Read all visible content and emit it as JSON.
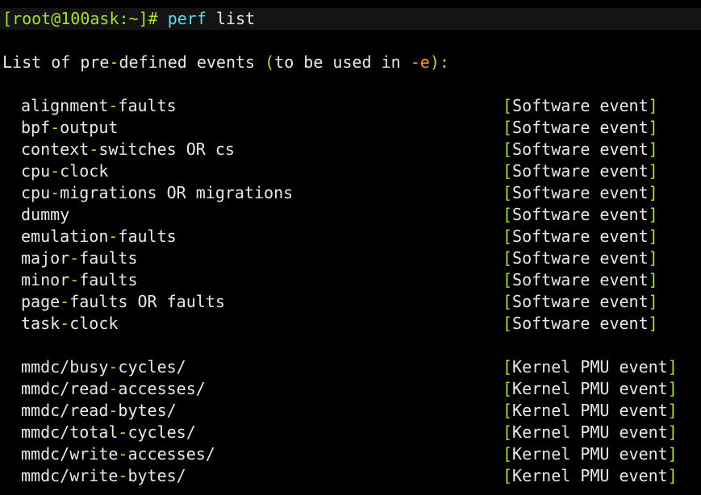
{
  "prompt": {
    "user_host": "[root@100ask:~]#",
    "command": "perf",
    "argument": "list"
  },
  "header": {
    "text_start": "List of pre",
    "dash": "-",
    "text_mid": "defined events ",
    "paren_open": "(",
    "text_in": "to be used in ",
    "flag": "-e",
    "paren_close": ")",
    "colon": ":"
  },
  "software_events": [
    {
      "name": "alignment-faults",
      "type": "Software event"
    },
    {
      "name": "bpf-output",
      "type": "Software event"
    },
    {
      "name": "context-switches OR cs",
      "type": "Software event"
    },
    {
      "name": "cpu-clock",
      "type": "Software event"
    },
    {
      "name": "cpu-migrations OR migrations",
      "type": "Software event"
    },
    {
      "name": "dummy",
      "type": "Software event"
    },
    {
      "name": "emulation-faults",
      "type": "Software event"
    },
    {
      "name": "major-faults",
      "type": "Software event"
    },
    {
      "name": "minor-faults",
      "type": "Software event"
    },
    {
      "name": "page-faults OR faults",
      "type": "Software event"
    },
    {
      "name": "task-clock",
      "type": "Software event"
    }
  ],
  "pmu_events": [
    {
      "name": "mmdc/busy-cycles/",
      "type": "Kernel PMU event"
    },
    {
      "name": "mmdc/read-accesses/",
      "type": "Kernel PMU event"
    },
    {
      "name": "mmdc/read-bytes/",
      "type": "Kernel PMU event"
    },
    {
      "name": "mmdc/total-cycles/",
      "type": "Kernel PMU event"
    },
    {
      "name": "mmdc/write-accesses/",
      "type": "Kernel PMU event"
    },
    {
      "name": "mmdc/write-bytes/",
      "type": "Kernel PMU event"
    }
  ],
  "colors": {
    "background": "#000000",
    "text": "#e8e8e8",
    "accent_green": "#a6e22e",
    "accent_blue": "#66d9ef",
    "accent_orange": "#fd971f"
  }
}
